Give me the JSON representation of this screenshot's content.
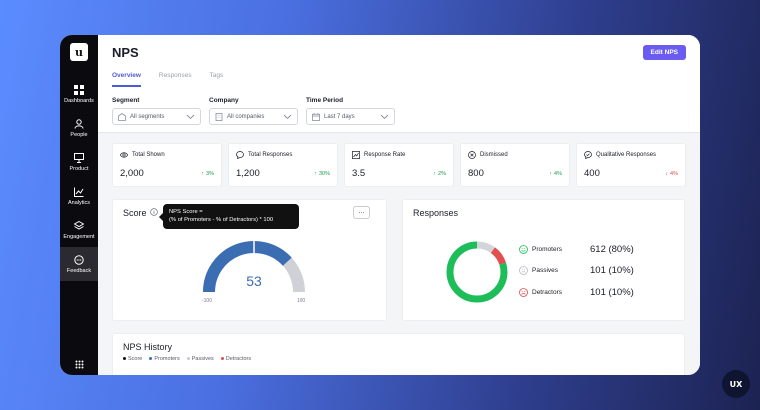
{
  "app": {
    "logo_letter": "u",
    "badge": "UX"
  },
  "sidebar": {
    "items": [
      {
        "label": "Dashboards",
        "icon": "dashboard-icon"
      },
      {
        "label": "People",
        "icon": "people-icon"
      },
      {
        "label": "Product",
        "icon": "product-icon"
      },
      {
        "label": "Analytics",
        "icon": "analytics-icon"
      },
      {
        "label": "Engagement",
        "icon": "engagement-icon"
      },
      {
        "label": "Feedback",
        "icon": "feedback-icon",
        "active": true
      }
    ]
  },
  "header": {
    "title": "NPS",
    "edit_label": "Edit NPS",
    "tabs": [
      {
        "label": "Overview",
        "active": true
      },
      {
        "label": "Responses"
      },
      {
        "label": "Tags"
      }
    ]
  },
  "filters": [
    {
      "label": "Segment",
      "value": "All segments",
      "icon": "segment-icon"
    },
    {
      "label": "Company",
      "value": "All companies",
      "icon": "building-icon"
    },
    {
      "label": "Time Period",
      "value": "Last 7 days",
      "icon": "calendar-icon"
    }
  ],
  "stats": [
    {
      "title": "Total Shown",
      "value": "2,000",
      "delta": "3%",
      "direction": "up",
      "icon": "eye-icon"
    },
    {
      "title": "Total Responses",
      "value": "1,200",
      "delta": "30%",
      "direction": "up",
      "icon": "chat-icon"
    },
    {
      "title": "Response Rate",
      "value": "3.5",
      "delta": "2%",
      "direction": "up",
      "icon": "trend-icon"
    },
    {
      "title": "Dismissed",
      "value": "800",
      "delta": "4%",
      "direction": "up",
      "icon": "x-circle-icon"
    },
    {
      "title": "Qualitative Responses",
      "value": "400",
      "delta": "4%",
      "direction": "down",
      "icon": "chat-check-icon"
    }
  ],
  "score": {
    "title": "Score",
    "tooltip_line1": "NPS Score =",
    "tooltip_line2": "(% of Promoters - % of Detractors) * 100",
    "more": "...",
    "value": "53",
    "min_label": "-100",
    "max_label": "100",
    "score_number": 53
  },
  "responses": {
    "title": "Responses",
    "rows": [
      {
        "label": "Promoters",
        "value": "612 (80%)",
        "fraction": 0.8,
        "color": "#1dbd5a"
      },
      {
        "label": "Passives",
        "value": "101 (10%)",
        "fraction": 0.1,
        "color": "#d3d5da"
      },
      {
        "label": "Detractors",
        "value": "101 (10%)",
        "fraction": 0.1,
        "color": "#e05050"
      }
    ]
  },
  "history": {
    "title": "NPS History",
    "legend": [
      {
        "label": "Score",
        "color": "#111111"
      },
      {
        "label": "Promoters",
        "color": "#3b6db3"
      },
      {
        "label": "Passives",
        "color": "#c7c9cf"
      },
      {
        "label": "Detractors",
        "color": "#e05050"
      }
    ]
  },
  "colors": {
    "accent": "#6a5cf0",
    "gauge_blue": "#3b6db3",
    "gauge_grey": "#cfd1d6"
  }
}
